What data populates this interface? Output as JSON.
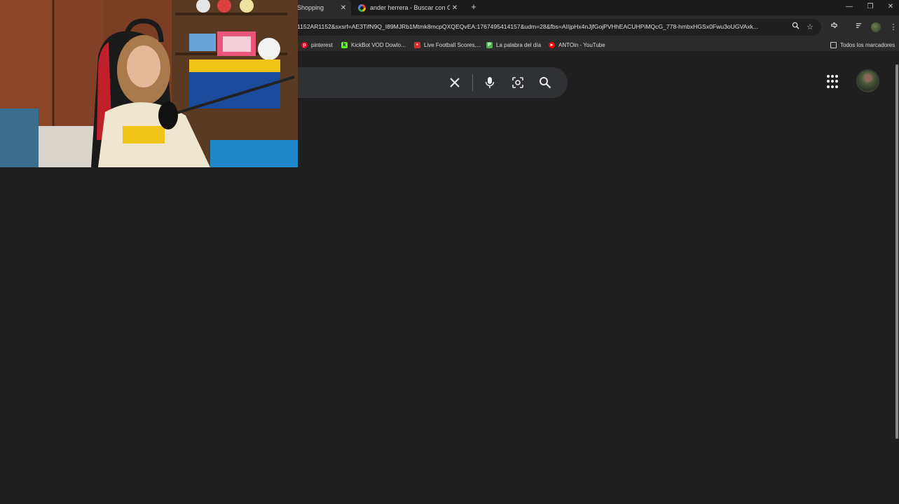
{
  "tabs": [
    {
      "title": "Shopping",
      "active": true,
      "close_label": "✕"
    },
    {
      "title": "ander herrera - Buscar con Goo",
      "active": false,
      "close_label": "✕"
    }
  ],
  "newtab_label": "+",
  "window_controls": {
    "minimize": "—",
    "restore": "❐",
    "close": "✕"
  },
  "address_bar": {
    "url": "1152AR1152&sxsrf=AE3TifN9Q_I89MJRb1Mtmk8mcpQXQEQvEA:1767495414157&udm=28&fbs=AIIjpHx4nJjfGojPVHhEACUHPiMQcG_778-hmbxHGSx0Fwu3oUGVAxk..."
  },
  "bookmarks": [
    {
      "label": "pinterest",
      "icon": "pinterest-icon",
      "color": "#e60023"
    },
    {
      "label": "KickBot VOD Dowlo...",
      "icon": "kickbot-icon",
      "color": "#53fc18"
    },
    {
      "label": "Live Football Scores,...",
      "icon": "livescore-icon",
      "color": "#d32f2f"
    },
    {
      "label": "La palabra del día",
      "icon": "palabra-icon",
      "color": "#4caf50"
    },
    {
      "label": "ANTOin - YouTube",
      "icon": "youtube-icon",
      "color": "#ff0000"
    }
  ],
  "bookmarks_folder": {
    "label": "Todos los marcadores",
    "icon": "folder-icon"
  },
  "search_bar": {
    "clear_icon": "close-icon",
    "voice_icon": "microphone-icon",
    "lens_icon": "camera-lens-icon",
    "search_icon": "search-icon"
  },
  "header_icons": {
    "apps": "apps-grid-icon",
    "avatar": "profile-avatar"
  },
  "colors": {
    "background": "#1f1f1f",
    "toolbar": "#2b2b2b",
    "searchbox": "#303134"
  }
}
